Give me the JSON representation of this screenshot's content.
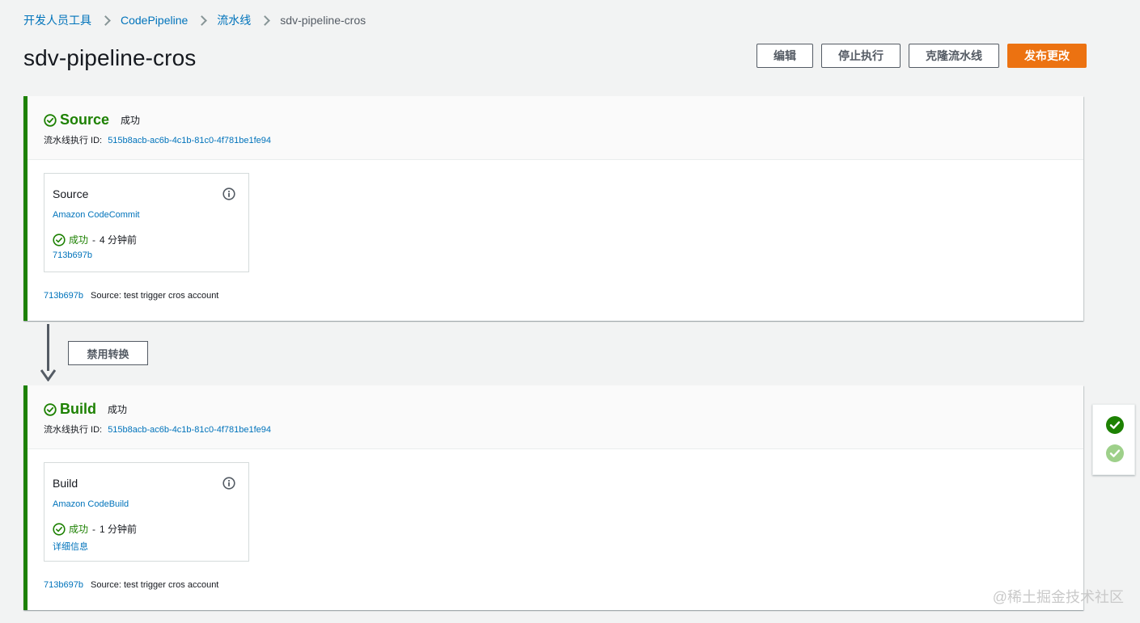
{
  "breadcrumb": {
    "items": [
      "开发人员工具",
      "CodePipeline",
      "流水线",
      "sdv-pipeline-cros"
    ]
  },
  "page": {
    "title": "sdv-pipeline-cros"
  },
  "actions": {
    "edit": "编辑",
    "stop": "停止执行",
    "clone": "克隆流水线",
    "release": "发布更改"
  },
  "stages": [
    {
      "title": "Source",
      "status": "成功",
      "exec_label": "流水线执行 ID:",
      "exec_id": "515b8acb-ac6b-4c1b-81c0-4f781be1fe94",
      "action": {
        "name": "Source",
        "provider": "Amazon CodeCommit",
        "status": "成功",
        "separator": "-",
        "time": "4 分钟前",
        "link": "713b697b"
      },
      "commit_id": "713b697b",
      "commit_message": "Source: test trigger cros account"
    },
    {
      "title": "Build",
      "status": "成功",
      "exec_label": "流水线执行 ID:",
      "exec_id": "515b8acb-ac6b-4c1b-81c0-4f781be1fe94",
      "action": {
        "name": "Build",
        "provider": "Amazon CodeBuild",
        "status": "成功",
        "separator": "-",
        "time": "1 分钟前",
        "link": "详细信息"
      },
      "commit_id": "713b697b",
      "commit_message": "Source: test trigger cros account"
    }
  ],
  "transition": {
    "button_label": "禁用转换"
  },
  "watermark": "@稀土掘金技术社区",
  "colors": {
    "success": "#1d8102",
    "success_light": "#9ed08a",
    "link": "#0073bb",
    "primary": "#ec7211"
  },
  "icons": {
    "success": "check-circle-icon",
    "info": "info-icon",
    "arrow": "arrow-down-icon"
  }
}
